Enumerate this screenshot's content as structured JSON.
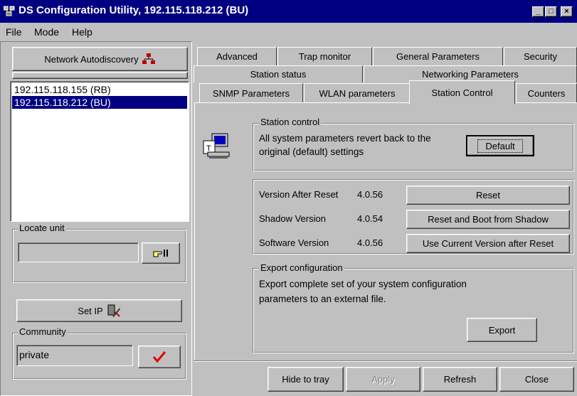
{
  "window": {
    "title": "DS Configuration Utility, 192.115.118.212  (BU)"
  },
  "menu": {
    "file": "File",
    "mode": "Mode",
    "help": "Help"
  },
  "left": {
    "autodiscovery_label": "Network Autodiscovery",
    "units": [
      "192.115.118.155  (RB)",
      "192.115.118.212  (BU)"
    ],
    "selected_index": 1,
    "locate_label": "Locate unit",
    "locate_value": "",
    "set_ip_label": "Set IP",
    "community_label": "Community",
    "community_value": "private"
  },
  "tabs": {
    "row1": [
      "Advanced",
      "Trap monitor",
      "General Parameters",
      "Security"
    ],
    "row2": [
      "Station status",
      "Networking Parameters"
    ],
    "row3": [
      "SNMP Parameters",
      "WLAN parameters",
      "Station Control",
      "Counters"
    ],
    "active": "Station Control"
  },
  "station_control": {
    "group_label": "Station control",
    "description": "All system parameters revert back to the original (default) settings",
    "default_button": "Default"
  },
  "versions": {
    "after_reset_label": "Version After Reset",
    "after_reset_value": "4.0.56",
    "shadow_label": "Shadow Version",
    "shadow_value": "4.0.54",
    "software_label": "Software Version",
    "software_value": "4.0.56",
    "reset_button": "Reset",
    "reset_boot_button": "Reset and Boot from Shadow",
    "use_current_button": "Use Current Version after Reset"
  },
  "export": {
    "group_label": "Export configuration",
    "description": "Export complete set of your system configuration parameters to an external file.",
    "button": "Export"
  },
  "bottom": {
    "hide": "Hide to tray",
    "apply": "Apply",
    "refresh": "Refresh",
    "close": "Close"
  }
}
